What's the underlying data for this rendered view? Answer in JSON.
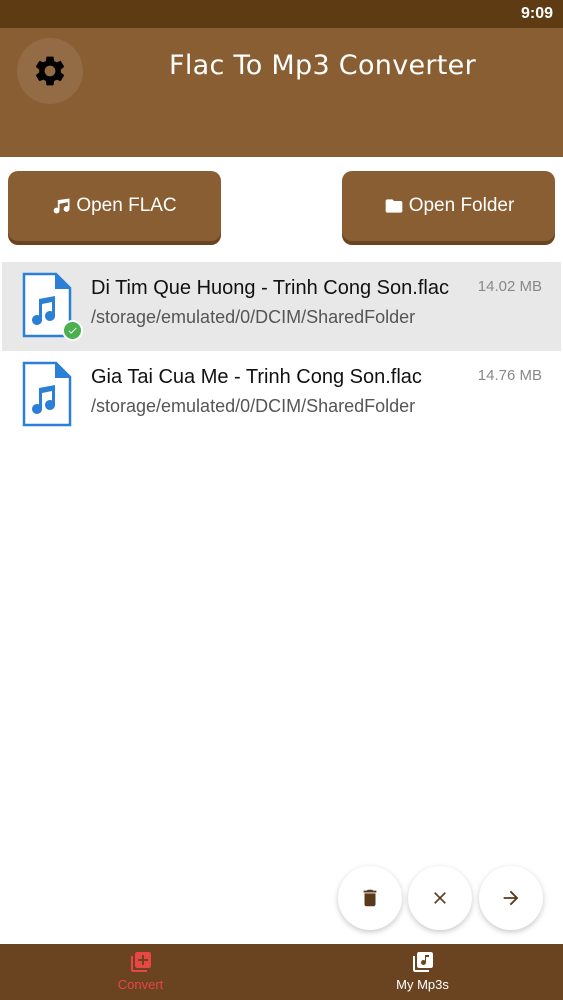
{
  "status_bar": {
    "time": "9:09"
  },
  "header": {
    "title": "Flac To Mp3 Converter",
    "settings_icon": "gear-icon"
  },
  "actions": {
    "open_flac": "Open FLAC",
    "open_folder": "Open Folder"
  },
  "files": [
    {
      "name": "Di Tim Que Huong - Trinh Cong Son.flac",
      "path": "/storage/emulated/0/DCIM/SharedFolder",
      "size": "14.02 MB",
      "selected": true
    },
    {
      "name": "Gia Tai Cua Me - Trinh Cong Son.flac",
      "path": "/storage/emulated/0/DCIM/SharedFolder",
      "size": "14.76 MB",
      "selected": false
    }
  ],
  "fab_icons": [
    "trash-icon",
    "close-icon",
    "arrow-right-icon"
  ],
  "bottom_nav": {
    "convert": "Convert",
    "my_mp3s": "My Mp3s"
  },
  "colors": {
    "header": "#8a5e33",
    "status_bar": "#5e3b13",
    "bottom_nav": "#6a4421",
    "active_nav": "#e84545",
    "check": "#4caf50",
    "file_icon": "#2b7fd4"
  }
}
